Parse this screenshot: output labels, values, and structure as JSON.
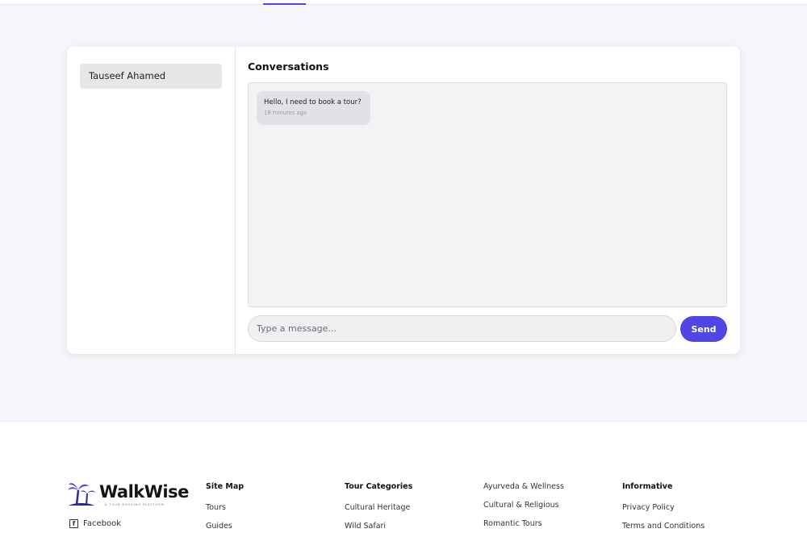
{
  "chat": {
    "contacts": [
      {
        "name": "Tauseef Ahamed"
      }
    ],
    "title": "Conversations",
    "messages": [
      {
        "text": "Hello, I need to book a tour?",
        "time": "18 minutes ago"
      }
    ],
    "input_placeholder": "Type a message...",
    "send_label": "Send"
  },
  "footer": {
    "logo_text": "WalkWise",
    "logo_tagline": "A TOUR BOOKING PLATFORM",
    "social": [
      {
        "label": "Facebook",
        "icon": "facebook-icon"
      }
    ],
    "site_map": {
      "heading": "Site Map",
      "links": [
        "Tours",
        "Guides"
      ]
    },
    "tour_categories": {
      "heading": "Tour Categories",
      "links": [
        "Cultural Heritage",
        "Wild Safari"
      ]
    },
    "more_categories": {
      "links": [
        "Ayurveda & Wellness",
        "Cultural & Religious",
        "Romantic Tours"
      ]
    },
    "informative": {
      "heading": "Informative",
      "links": [
        "Privacy Policy",
        "Terms and Conditions"
      ]
    }
  },
  "colors": {
    "accent": "#4f46e5",
    "page_bg": "#f6f6fa"
  }
}
